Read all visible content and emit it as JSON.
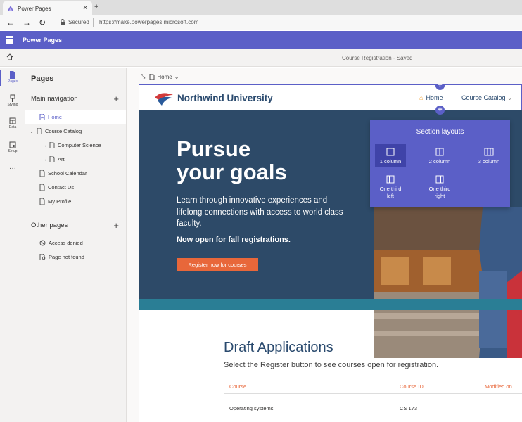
{
  "browser": {
    "tab_title": "Power Pages",
    "tab_close": "✕",
    "new_tab": "+",
    "security_label": "Secured",
    "url": "https://make.powerpages.microsoft.com"
  },
  "app": {
    "name": "Power Pages",
    "document_status": "Course Registration - Saved"
  },
  "rail": {
    "items": [
      {
        "label": "Pages",
        "icon": "page-icon"
      },
      {
        "label": "Styling",
        "icon": "brush-icon"
      },
      {
        "label": "Data",
        "icon": "table-icon"
      },
      {
        "label": "Setup",
        "icon": "setup-icon"
      },
      {
        "label": "···",
        "icon": "more-icon"
      }
    ]
  },
  "pages_panel": {
    "title": "Pages",
    "main_nav_label": "Main navigation",
    "other_pages_label": "Other pages",
    "main_nav": [
      {
        "label": "Home"
      },
      {
        "label": "Course Catalog"
      },
      {
        "label": "Computer Science"
      },
      {
        "label": "Art"
      },
      {
        "label": "School Calendar"
      },
      {
        "label": "Contact Us"
      },
      {
        "label": "My Profile"
      }
    ],
    "other_pages": [
      {
        "label": "Access denied"
      },
      {
        "label": "Page not found"
      }
    ]
  },
  "canvas": {
    "breadcrumb_page": "Home"
  },
  "site": {
    "brand": "Northwind University",
    "nav": {
      "home": "Home",
      "catalog": "Course Catalog"
    },
    "hero": {
      "title_line1": "Pursue",
      "title_line2": "your goals",
      "description": "Learn through innovative experiences and lifelong connections with access to world class faculty.",
      "open_text": "Now open for fall registrations.",
      "button_label": "Register now for courses"
    },
    "drafts": {
      "title": "Draft Applications",
      "subtitle": "Select the Register button to see courses open for registration.",
      "columns": [
        "Course",
        "Course ID",
        "Modified on"
      ],
      "rows": [
        {
          "course": "Operating systems",
          "course_id": "CS 173",
          "modified": ""
        }
      ]
    }
  },
  "section_layouts": {
    "title": "Section layouts",
    "options": [
      {
        "label_line1": "1 column",
        "label_line2": ""
      },
      {
        "label_line1": "2 column",
        "label_line2": ""
      },
      {
        "label_line1": "3 column",
        "label_line2": ""
      },
      {
        "label_line1": "One third",
        "label_line2": "left"
      },
      {
        "label_line1": "One third",
        "label_line2": "right"
      }
    ]
  },
  "colors": {
    "accent": "#5b5fc7",
    "hero_bg": "#2d4a68",
    "cta": "#e8673a"
  }
}
